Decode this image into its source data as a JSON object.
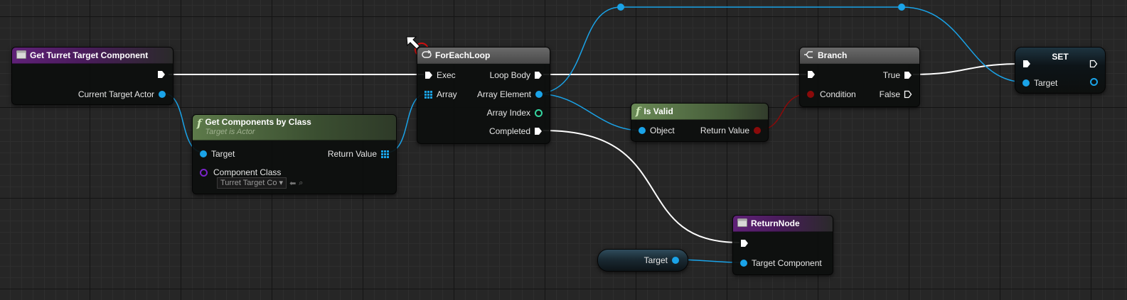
{
  "nodes": {
    "get_turret": {
      "title": "Get Turret Target Component",
      "output_label": "Current Target Actor"
    },
    "get_components": {
      "title": "Get Components by Class",
      "subtitle": "Target is Actor",
      "target_label": "Target",
      "return_label": "Return Value",
      "class_label": "Component Class",
      "class_value": "Turret Target Co"
    },
    "foreach": {
      "title": "ForEachLoop",
      "exec_label": "Exec",
      "array_label": "Array",
      "loop_body_label": "Loop Body",
      "element_label": "Array Element",
      "index_label": "Array Index",
      "completed_label": "Completed"
    },
    "is_valid": {
      "title": "Is Valid",
      "object_label": "Object",
      "return_label": "Return Value"
    },
    "branch": {
      "title": "Branch",
      "condition_label": "Condition",
      "true_label": "True",
      "false_label": "False"
    },
    "set": {
      "title": "SET",
      "target_label": "Target"
    },
    "return_node": {
      "title": "ReturnNode",
      "output_label": "Target Component"
    },
    "target_var": {
      "label": "Target"
    }
  },
  "colors": {
    "exec_wire": "#ffffff",
    "object_wire": "#1aa3e8",
    "bool_wire": "#8a0a0a",
    "pure_function_header": "#5d7a4a",
    "event_header": "#5f2177",
    "macro_header": "#5a5a5a"
  },
  "icons": {
    "function": "function-f-icon",
    "macro": "macro-loop-icon",
    "branch": "branch-icon",
    "entry": "function-entry-icon"
  }
}
